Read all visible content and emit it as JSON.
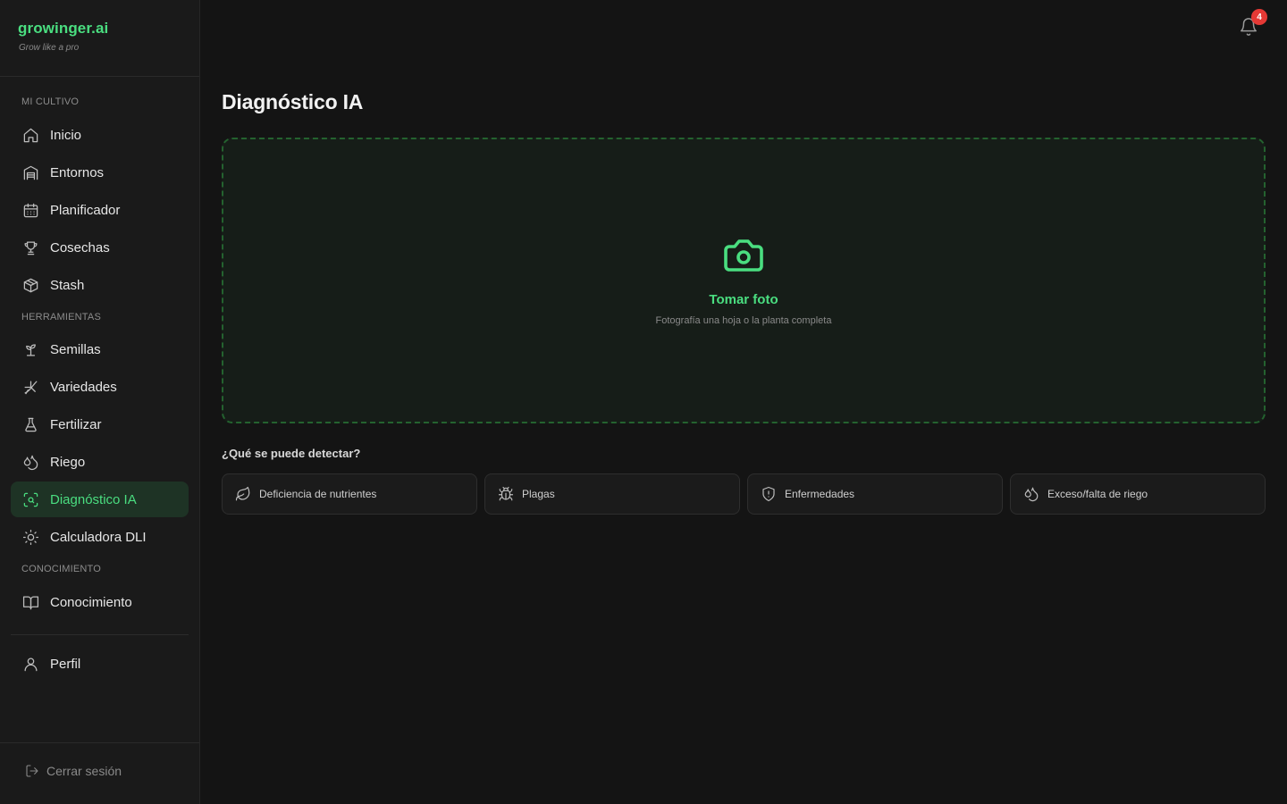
{
  "brand": {
    "name": "growinger.ai",
    "tagline": "Grow like a pro"
  },
  "sidebar": {
    "sections": [
      "MI CULTIVO",
      "HERRAMIENTAS",
      "CONOCIMIENTO"
    ],
    "items": [
      {
        "label": "Inicio",
        "icon": "home-icon"
      },
      {
        "label": "Entornos",
        "icon": "warehouse-icon"
      },
      {
        "label": "Planificador",
        "icon": "calendar-icon"
      },
      {
        "label": "Cosechas",
        "icon": "trophy-icon"
      },
      {
        "label": "Stash",
        "icon": "box-icon"
      },
      {
        "label": "Semillas",
        "icon": "sprout-icon"
      },
      {
        "label": "Variedades",
        "icon": "dna-icon"
      },
      {
        "label": "Fertilizar",
        "icon": "flask-icon"
      },
      {
        "label": "Riego",
        "icon": "droplets-icon"
      },
      {
        "label": "Diagnóstico IA",
        "icon": "scan-search-icon",
        "active": true
      },
      {
        "label": "Calculadora DLI",
        "icon": "sun-icon"
      },
      {
        "label": "Conocimiento",
        "icon": "book-open-icon"
      },
      {
        "label": "Perfil",
        "icon": "user-icon"
      }
    ],
    "logout": "Cerrar sesión"
  },
  "header": {
    "notifications_count": "4"
  },
  "main": {
    "title": "Diagnóstico IA",
    "dropzone": {
      "title": "Tomar foto",
      "subtitle": "Fotografía una hoja o la planta completa",
      "icon": "camera-icon"
    },
    "detect_heading": "¿Qué se puede detectar?",
    "detect_cards": [
      {
        "label": "Deficiencia de nutrientes",
        "icon": "leaf-icon"
      },
      {
        "label": "Plagas",
        "icon": "bug-icon"
      },
      {
        "label": "Enfermedades",
        "icon": "shield-alert-icon"
      },
      {
        "label": "Exceso/falta de riego",
        "icon": "droplets-icon"
      }
    ]
  },
  "colors": {
    "accent": "#4ade80",
    "active_bg": "#1e3325",
    "badge": "#e53935"
  }
}
